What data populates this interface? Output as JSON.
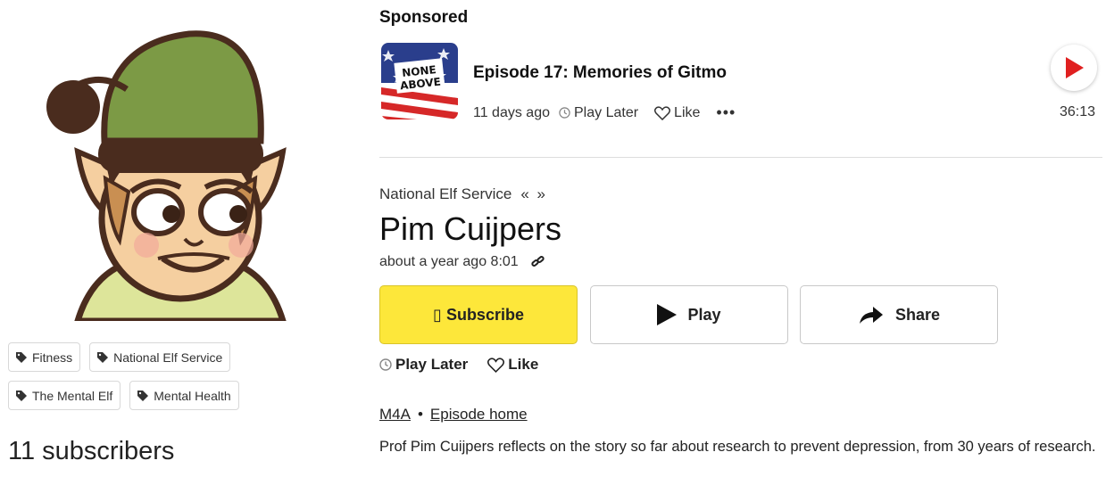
{
  "sidebar": {
    "tags": [
      {
        "label": "Fitness"
      },
      {
        "label": "National Elf Service"
      },
      {
        "label": "The Mental Elf"
      },
      {
        "label": "Mental Health"
      }
    ],
    "subscribers": "11 subscribers"
  },
  "sponsored": {
    "label": "Sponsored",
    "artwork_text_1": "NONE",
    "artwork_text_2": "ABOVE",
    "title": "Episode 17: Memories of Gitmo",
    "age": "11 days ago",
    "play_later": "Play Later",
    "like": "Like",
    "more": "•••",
    "duration": "36:13"
  },
  "episode": {
    "podcast": "National Elf Service",
    "nav_arrows": "« »",
    "title": "Pim Cuijpers",
    "age": "about a year ago",
    "length": "8:01",
    "buttons": {
      "subscribe": "▯ Subscribe",
      "play": "Play",
      "share": "Share"
    },
    "play_later": "Play Later",
    "like": "Like",
    "format_link": "M4A",
    "separator": "•",
    "home_link": "Episode home",
    "description": "Prof Pim Cuijpers reflects on the story so far about research to prevent depression, from 30 years of research."
  },
  "colors": {
    "subscribe_bg": "#fde73a",
    "play_red": "#e02020",
    "elf_hat": "#7c9a45",
    "elf_brown": "#4a2c1e",
    "elf_skin": "#f5cfa0"
  }
}
